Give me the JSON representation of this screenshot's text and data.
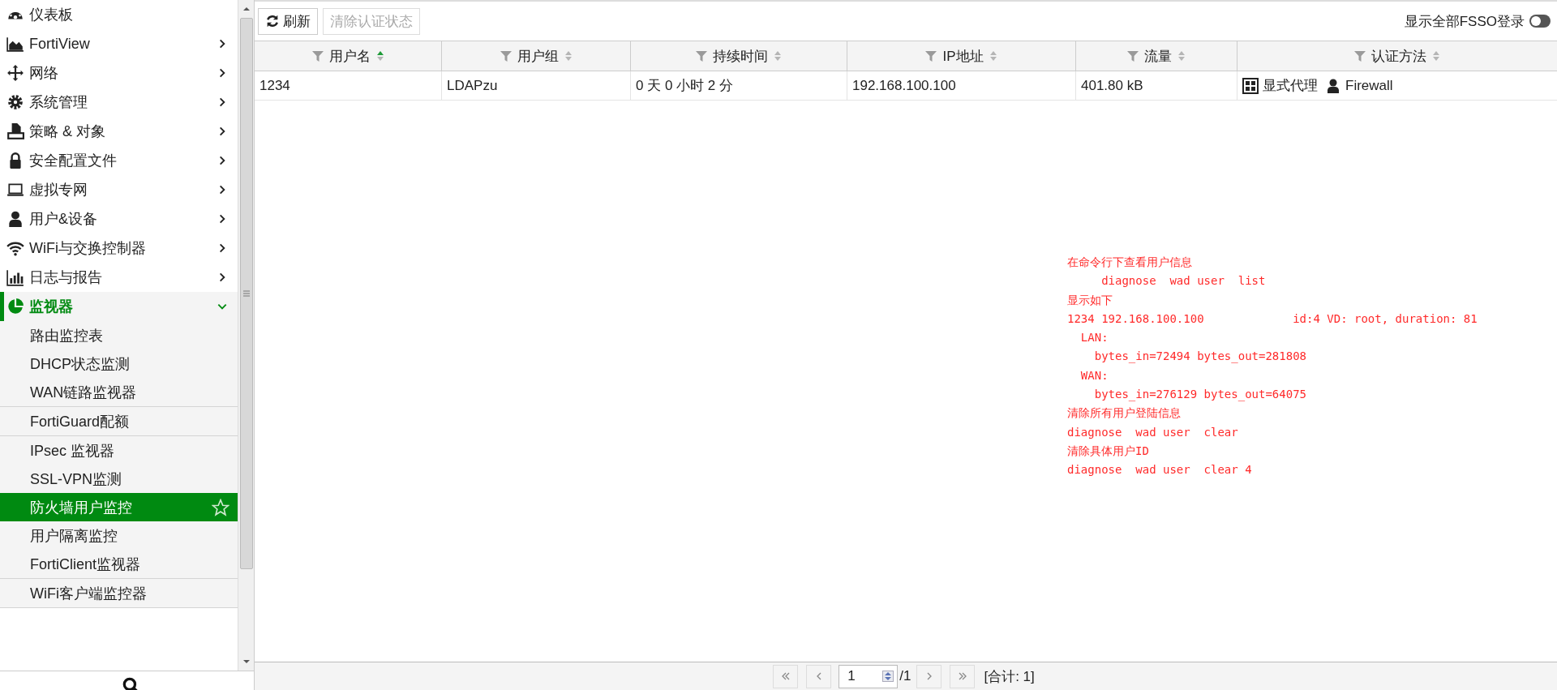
{
  "sidebar": {
    "items": [
      {
        "kind": "link",
        "label": "仪表板",
        "expanded": false
      },
      {
        "kind": "menu",
        "label": "FortiView",
        "expanded": false
      },
      {
        "kind": "menu",
        "label": "网络",
        "expanded": false
      },
      {
        "kind": "menu",
        "label": "系统管理",
        "expanded": false
      },
      {
        "kind": "menu",
        "label": "策略 & 对象",
        "expanded": false
      },
      {
        "kind": "menu",
        "label": "安全配置文件",
        "expanded": false
      },
      {
        "kind": "menu",
        "label": "虚拟专网",
        "expanded": false
      },
      {
        "kind": "menu",
        "label": "用户&设备",
        "expanded": false
      },
      {
        "kind": "menu",
        "label": "WiFi与交换控制器",
        "expanded": false
      },
      {
        "kind": "menu",
        "label": "日志与报告",
        "expanded": false
      },
      {
        "kind": "menu",
        "label": "监视器",
        "expanded": true,
        "children": [
          [
            {
              "label": "路由监控表",
              "selected": false
            },
            {
              "label": "DHCP状态监测",
              "selected": false
            },
            {
              "label": "WAN链路监视器",
              "selected": false
            }
          ],
          [
            {
              "label": "FortiGuard配额",
              "selected": false
            }
          ],
          [
            {
              "label": "IPsec 监视器",
              "selected": false
            },
            {
              "label": "SSL-VPN监测",
              "selected": false
            },
            {
              "label": "防火墙用户监控",
              "selected": true
            },
            {
              "label": "用户隔离监控",
              "selected": false
            },
            {
              "label": "FortiClient监视器",
              "selected": false
            }
          ],
          [
            {
              "label": "WiFi客户端监控器",
              "selected": false
            }
          ]
        ]
      }
    ]
  },
  "toolbar": {
    "buttons": [
      {
        "label": "刷新",
        "disabled": false
      },
      {
        "label": "清除认证状态",
        "disabled": true
      }
    ],
    "toggle": {
      "label": "显示全部FSSO登录",
      "on": false
    }
  },
  "table": {
    "columns": [
      {
        "label": "用户名",
        "sorted": true
      },
      {
        "label": "用户组",
        "sorted": false
      },
      {
        "label": "持续时间",
        "sorted": false
      },
      {
        "label": "IP地址",
        "sorted": false
      },
      {
        "label": "流量",
        "sorted": false
      },
      {
        "label": "认证方法",
        "sorted": false
      }
    ],
    "rows": [
      {
        "cells": [
          "1234",
          "LDAPzu",
          "0 天 0 小时 2 分",
          "192.168.100.100",
          "401.80 kB"
        ],
        "auth": [
          {
            "kind": "proxy",
            "text": "显式代理"
          },
          {
            "kind": "user",
            "text": "Firewall"
          }
        ]
      }
    ]
  },
  "annotation": {
    "lines": [
      "在命令行下查看用户信息",
      "     diagnose  wad user  list",
      "显示如下",
      "1234 192.168.100.100             id:4 VD: root, duration: 81",
      "  LAN:",
      "    bytes_in=72494 bytes_out=281808",
      "  WAN:",
      "    bytes_in=276129 bytes_out=64075",
      "清除所有用户登陆信息",
      "diagnose  wad user  clear",
      "清除具体用户ID",
      "diagnose  wad user  clear 4"
    ]
  },
  "pagination": {
    "page": "1",
    "total_pages": "/1",
    "count": "[合计: 1]"
  }
}
